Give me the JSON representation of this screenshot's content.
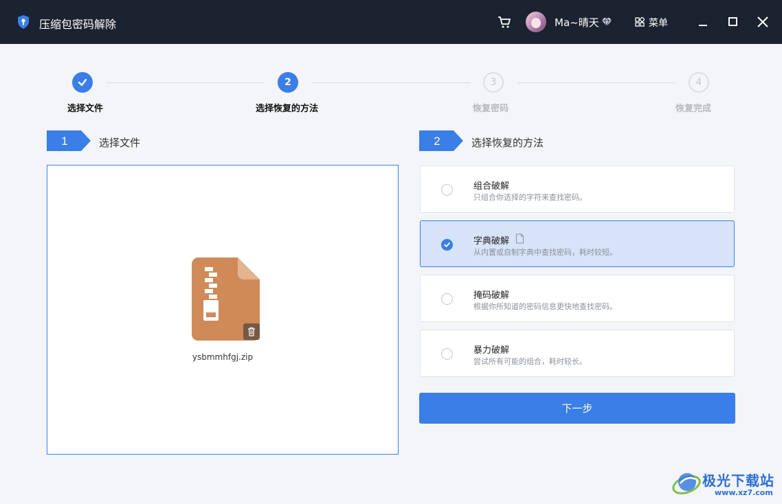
{
  "window": {
    "title": "压缩包密码解除",
    "user_name": "Ma~晴天",
    "menu_label": "菜单"
  },
  "stepper": {
    "steps": [
      {
        "number": "1",
        "label": "选择文件",
        "state": "done"
      },
      {
        "number": "2",
        "label": "选择恢复的方法",
        "state": "active"
      },
      {
        "number": "3",
        "label": "恢复密码",
        "state": "todo"
      },
      {
        "number": "4",
        "label": "恢复完成",
        "state": "todo"
      }
    ]
  },
  "file_section": {
    "number": "1",
    "title": "选择文件",
    "file_name": "ysbmmhfgj.zip"
  },
  "method_section": {
    "number": "2",
    "title": "选择恢复的方法",
    "methods": [
      {
        "title": "组合破解",
        "desc": "只组合你选择的字符来查找密码。",
        "selected": false
      },
      {
        "title": "字典破解",
        "desc": "从内置或自制字典中查找密码，耗时较短。",
        "selected": true
      },
      {
        "title": "掩码破解",
        "desc": "根据你所知道的密码信息更快地查找密码。",
        "selected": false
      },
      {
        "title": "暴力破解",
        "desc": "尝试所有可能的组合，耗时较长。",
        "selected": false
      }
    ],
    "next_label": "下一步"
  },
  "watermark": {
    "name": "极光下载站",
    "url": "www.xz7.com"
  },
  "colors": {
    "accent": "#3a7ee8",
    "titlebar": "#1b2230",
    "zip": "#cf8a58"
  }
}
